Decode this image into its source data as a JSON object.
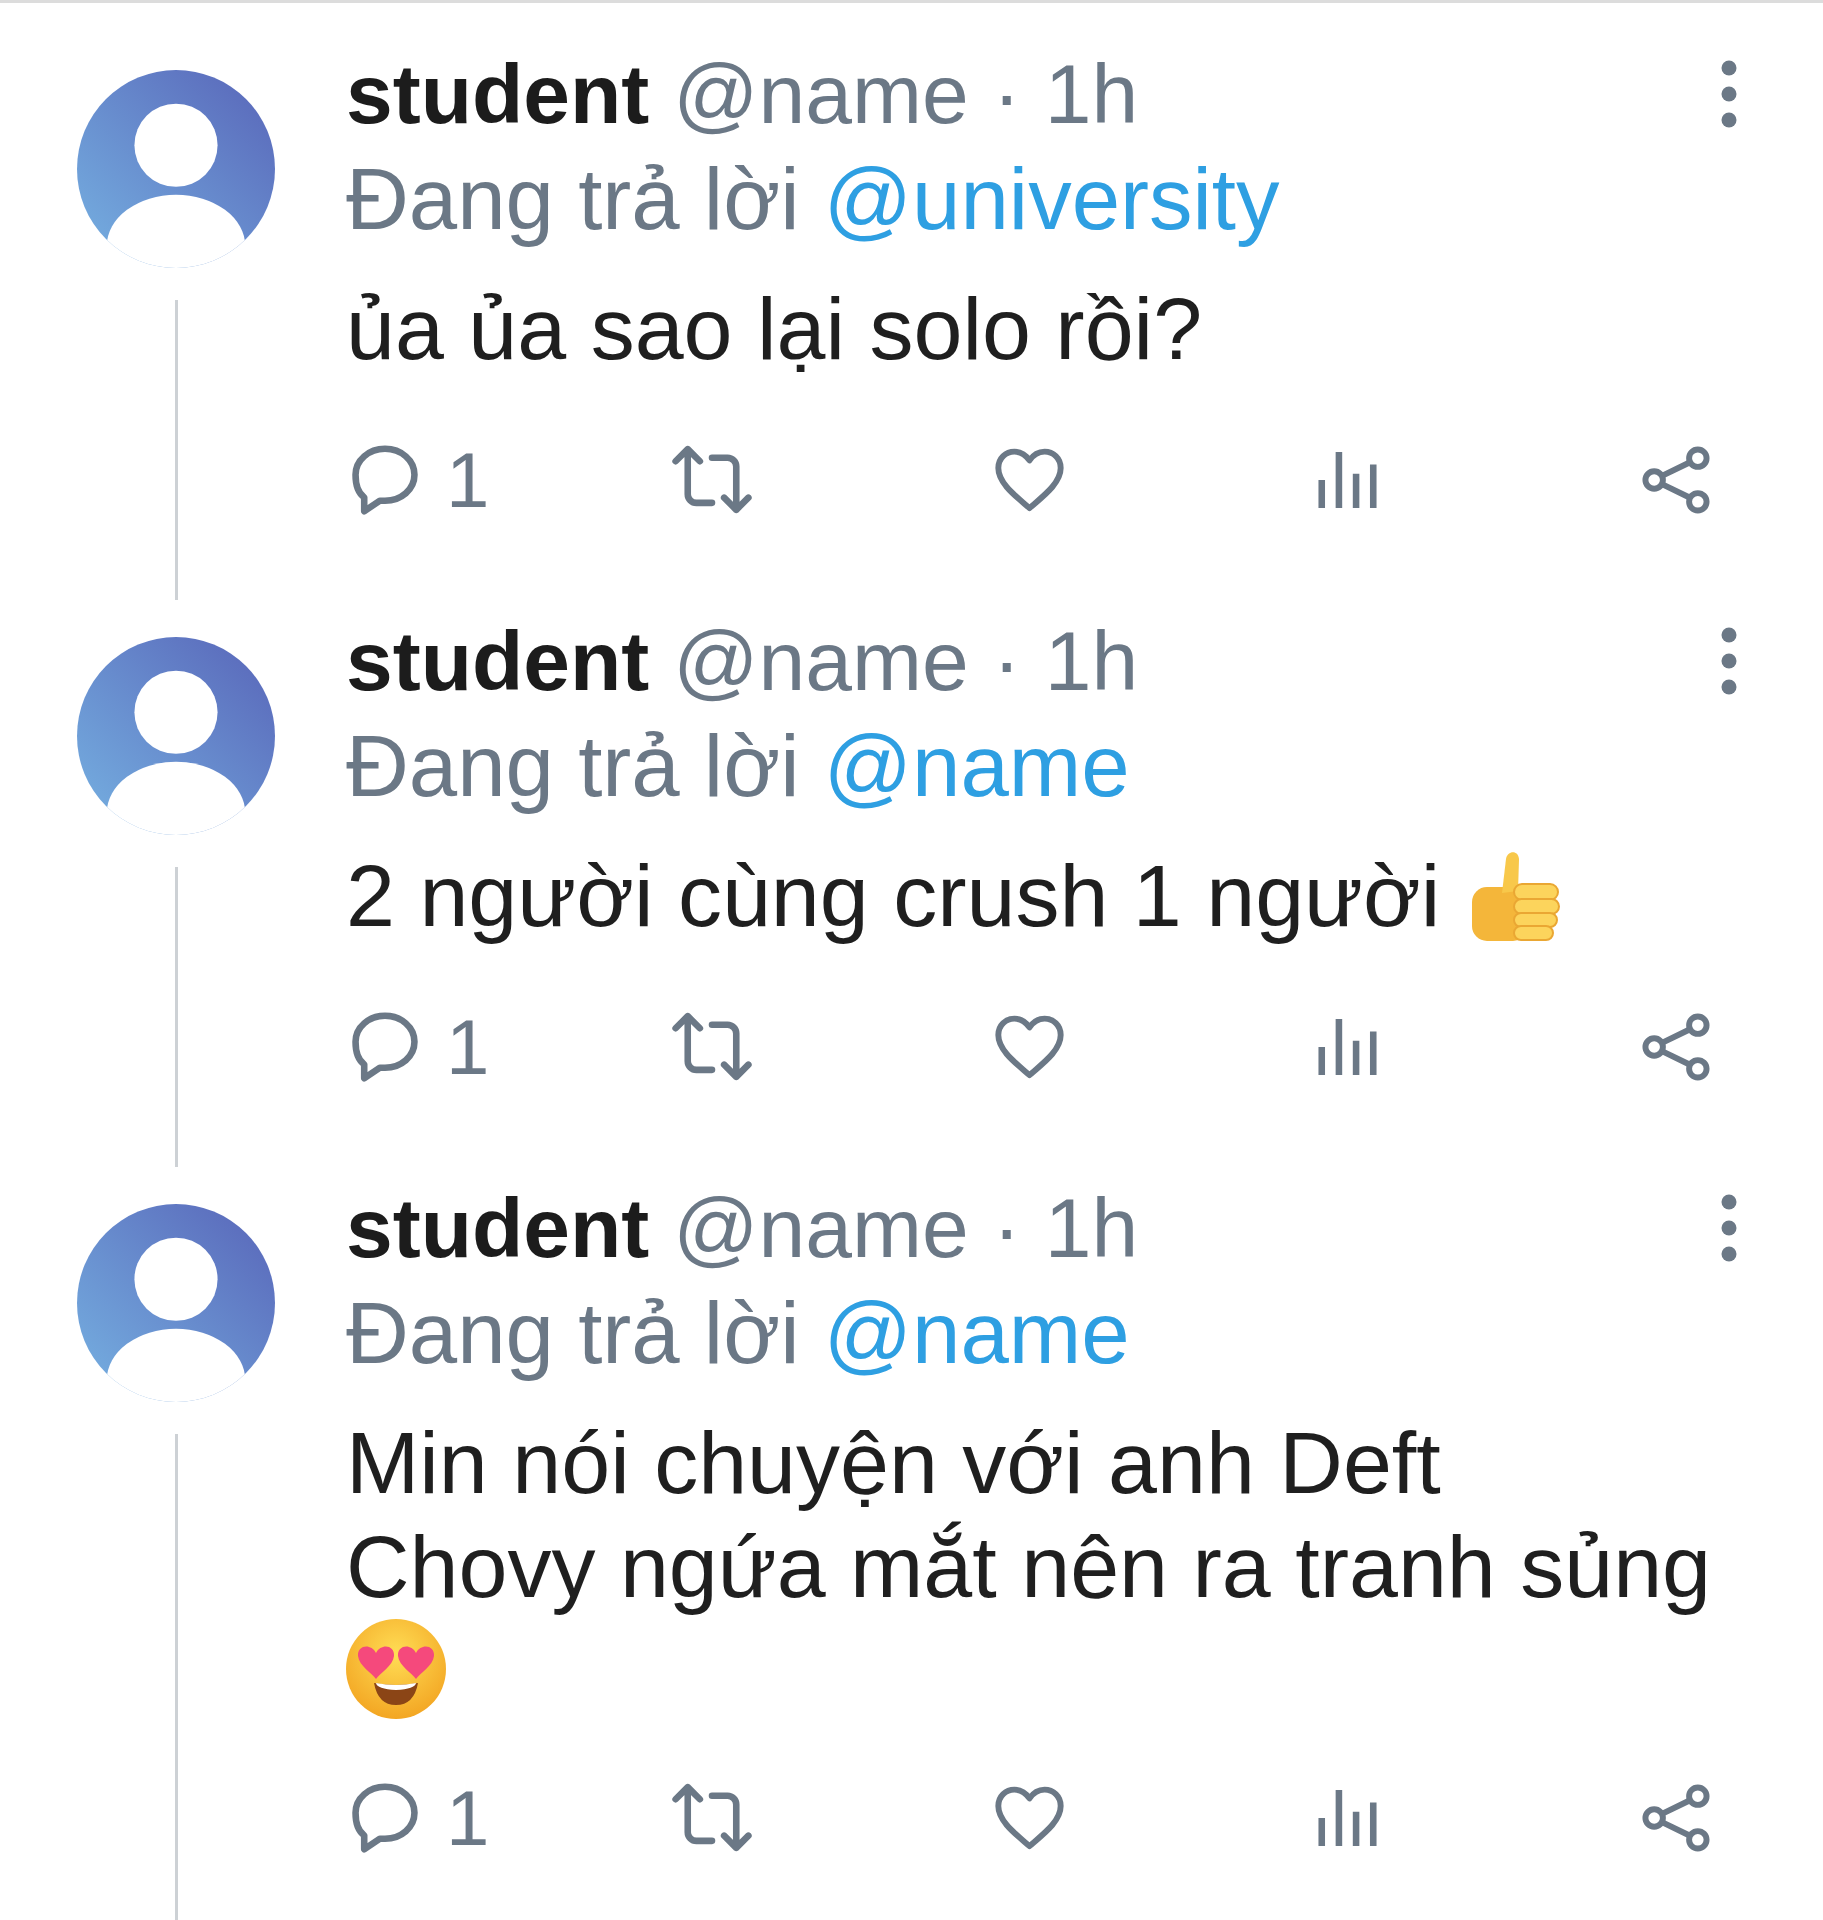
{
  "posts": [
    {
      "author": "student",
      "handle": "@name",
      "separator": "·",
      "time": "1h",
      "reply_prefix": "Đang trả lời",
      "reply_to": "@university",
      "text": "ủa ủa sao lại solo rồi?",
      "reply_count": "1",
      "liked": false
    },
    {
      "author": "student",
      "handle": "@name",
      "separator": "·",
      "time": "1h",
      "reply_prefix": "Đang trả lời",
      "reply_to": "@name",
      "text": "2 người cùng crush 1 người",
      "emoji": {
        "kind": "thumbs_up"
      },
      "reply_count": "1",
      "liked": false
    },
    {
      "author": "student",
      "handle": "@name",
      "separator": "·",
      "time": "1h",
      "reply_prefix": "Đang trả lời",
      "reply_to": "@name",
      "text": "Min nói chuyện với anh Deft\nChovy ngứa mắt nên ra tranh sủng",
      "emoji": {
        "kind": "heart_eyes"
      },
      "reply_count": "1",
      "liked": false
    }
  ]
}
